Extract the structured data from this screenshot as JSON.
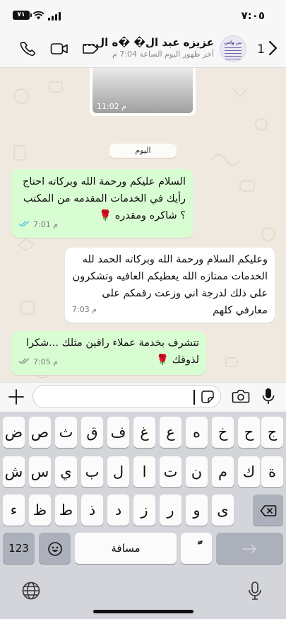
{
  "status": {
    "time": "٧:٠٥",
    "battery": "٧١"
  },
  "header": {
    "back_count": "1",
    "contact_name": "عزيزه عبد ال� �ه ال...",
    "last_seen": "آخر ظهور اليوم الساعة 7:04 م",
    "avatar_title": "بي واس"
  },
  "chat": {
    "media_time": "11:02 م",
    "day_label": "اليوم",
    "messages": [
      {
        "direction": "out",
        "text": "السلام عليكم ورحمة الله وبركاته احتاج رأيك في الخدمات المقدمه من المكتب ؟ شاكره ومقدره 🌹",
        "time": "7:01 م",
        "status": "read"
      },
      {
        "direction": "in",
        "text": "وعليكم السلام ورحمة الله وبركاته الحمد لله الخدمات ممتازه  الله يعطيكم العافيه وتشكرون على ذلك لدرجة اني وزعت رقمكم على معارفي كلهم",
        "time": "7:03 م"
      },
      {
        "direction": "out",
        "text": "تتشرف بخدمة عملاء راقين مثلك ...شكرا لذوقك 🌹",
        "time": "7:05 م",
        "status": "delivered"
      }
    ]
  },
  "input": {
    "placeholder": ""
  },
  "keyboard": {
    "row1": [
      "ض",
      "ص",
      "ث",
      "ق",
      "ف",
      "غ",
      "ع",
      "ه",
      "خ",
      "ح",
      "ج"
    ],
    "row2": [
      "ش",
      "س",
      "ي",
      "ب",
      "ل",
      "ا",
      "ت",
      "ن",
      "م",
      "ك",
      "ة"
    ],
    "row3": [
      "ء",
      "ظ",
      "ط",
      "ذ",
      "د",
      "ز",
      "ر",
      "و",
      "ى"
    ],
    "numbers_label": "123",
    "space_label": "مسافة",
    "diacritic_label": "ًّ"
  },
  "colors": {
    "outgoing_bubble": "#d9fdd3",
    "incoming_bubble": "#ffffff",
    "chat_background": "#efe9df",
    "read_ticks": "#53bdeb"
  },
  "icons": [
    "back-chevron-icon",
    "label-icon",
    "video-call-icon",
    "phone-icon",
    "plus-icon",
    "sticker-icon",
    "camera-icon",
    "microphone-icon",
    "emoji-icon",
    "backspace-icon",
    "return-icon",
    "globe-icon",
    "dictation-mic-icon"
  ]
}
